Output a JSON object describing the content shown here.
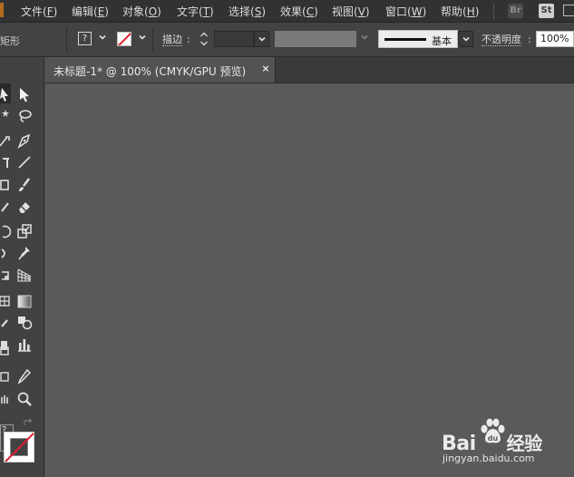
{
  "menubar": {
    "items": [
      {
        "label": "文件",
        "key": "F"
      },
      {
        "label": "编辑",
        "key": "E"
      },
      {
        "label": "对象",
        "key": "O"
      },
      {
        "label": "文字",
        "key": "T"
      },
      {
        "label": "选择",
        "key": "S"
      },
      {
        "label": "效果",
        "key": "C"
      },
      {
        "label": "视图",
        "key": "V"
      },
      {
        "label": "窗口",
        "key": "W"
      },
      {
        "label": "帮助",
        "key": "H"
      }
    ],
    "bridge_label": "Br",
    "stock_label": "St"
  },
  "controlbar": {
    "tool_name": "矩形",
    "fill_symbol": "?",
    "stroke_label": "描边",
    "stroke_colon": ":",
    "brush_label": "基本",
    "opacity_label": "不透明度",
    "opacity_colon": ":",
    "opacity_value": "100%"
  },
  "document": {
    "tab_title": "未标题-1* @ 100% (CMYK/GPU 预览)",
    "close_symbol": "×"
  },
  "toolbar": {
    "fill_symbol": "?",
    "tools_right": [
      "direct-selection",
      "lasso",
      "pen",
      "line-segment",
      "paintbrush",
      "eraser",
      "scale",
      "puppet-warp",
      "perspective-grid",
      "gradient",
      "shape-builder",
      "column-graph",
      "slice",
      "zoom"
    ],
    "tools_left": [
      "selection",
      "magic-wand",
      "curvature",
      "type",
      "rectangle",
      "pencil",
      "rotate",
      "width",
      "free-transform",
      "mesh",
      "eyedropper",
      "symbol-sprayer",
      "artboard",
      "hand"
    ]
  },
  "watermark": {
    "brand_left": "Bai",
    "brand_right": "经验",
    "url": "jingyan.baidu.com"
  },
  "colors": {
    "canvas": "#5a5a5a",
    "panel": "#424242",
    "menubar": "#323232",
    "stroke_none_red": "#e0202a"
  }
}
